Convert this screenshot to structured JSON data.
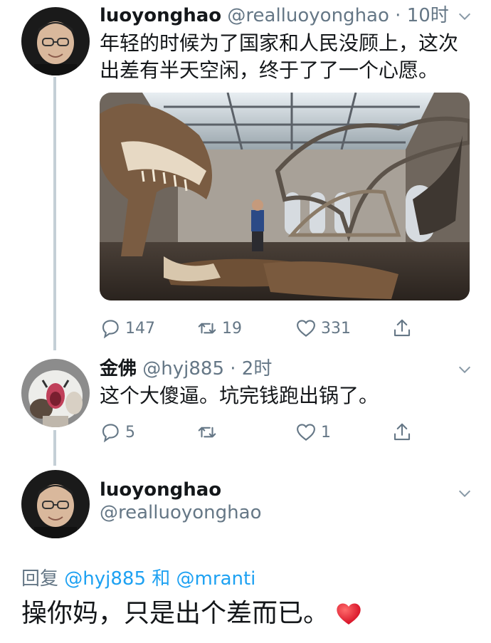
{
  "tweet1": {
    "name": "luoyonghao",
    "handle": "@realluoyonghao",
    "separator": "·",
    "time": "10时",
    "text_line1": "年轻的时候为了国家和人民没顾上，这次",
    "text_line2": "出差有半天空闲，终于了了一个心愿。",
    "reply_count": "147",
    "retweet_count": "19",
    "like_count": "331"
  },
  "tweet2": {
    "name": "金佛",
    "handle": "@hyj885",
    "separator": "·",
    "time": "2时",
    "text": "这个大傻逼。坑完钱跑出锅了。",
    "reply_count": "5",
    "like_count": "1"
  },
  "tweet3": {
    "name": "luoyonghao",
    "handle": "@realluoyonghao",
    "reply_label": "回复",
    "mention1": "@hyj885",
    "and_label": "和",
    "mention2": "@mranti",
    "text": "操你妈，只是出个差而已。"
  },
  "colors": {
    "secondary": "#657786",
    "link": "#1da1f2",
    "heart": "#e0245e",
    "thread_line": "#c4cfd6"
  }
}
